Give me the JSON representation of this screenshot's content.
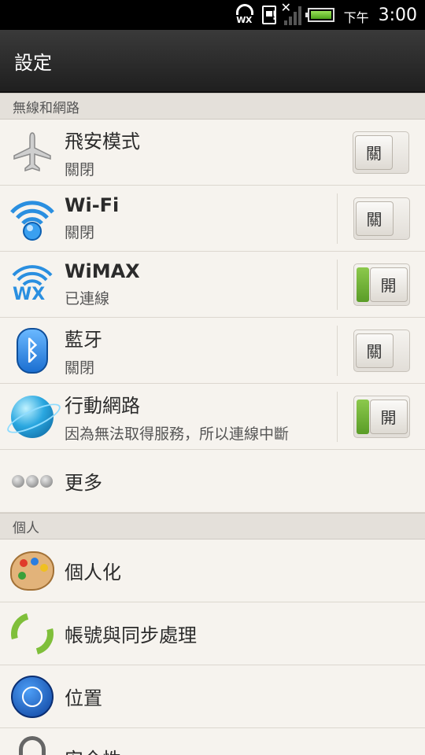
{
  "status_bar": {
    "time_prefix": "下午",
    "time": "3:00",
    "wimax_label": "WX",
    "sim_alert": "!",
    "no_signal_mark": "✕"
  },
  "title_bar": {
    "title": "設定"
  },
  "sections": {
    "wireless": "無線和網路",
    "personal": "個人"
  },
  "rows": {
    "airplane": {
      "title": "飛安模式",
      "subtitle": "關閉",
      "toggle": "關",
      "state": "off"
    },
    "wifi": {
      "title": "Wi-Fi",
      "subtitle": "關閉",
      "toggle": "關",
      "state": "off"
    },
    "wimax": {
      "title": "WiMAX",
      "subtitle": "已連線",
      "toggle": "開",
      "state": "on",
      "icon_label": "WX"
    },
    "bluetooth": {
      "title": "藍牙",
      "subtitle": "關閉",
      "toggle": "關",
      "state": "off"
    },
    "mobile": {
      "title": "行動網路",
      "subtitle": "因為無法取得服務，所以連線中斷",
      "toggle": "開",
      "state": "on"
    },
    "more": {
      "title": "更多"
    },
    "personalize": {
      "title": "個人化"
    },
    "accounts": {
      "title": "帳號與同步處理"
    },
    "location": {
      "title": "位置"
    },
    "security": {
      "title": "安全性"
    }
  },
  "colors": {
    "accent_green": "#6fb23a",
    "title_bar": "#2a2a2a",
    "background": "#f6f3ee"
  }
}
